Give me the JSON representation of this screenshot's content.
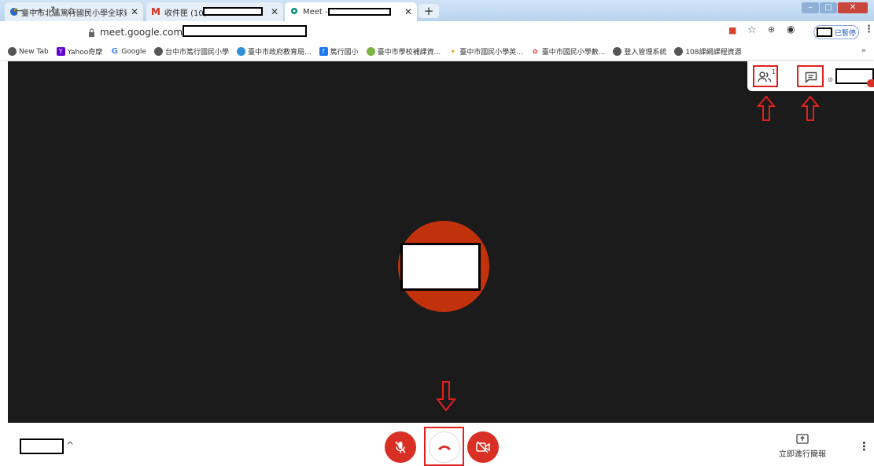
{
  "tabs": [
    {
      "title": "臺中市北區篤行國民小學全球資訊網",
      "active": false
    },
    {
      "title": "收件匣 (10)",
      "active": false
    },
    {
      "title": "Meet - ",
      "active": true
    }
  ],
  "address": {
    "url": "meet.google.com/o"
  },
  "profile": {
    "label": "已暫停"
  },
  "bookmarks": [
    {
      "label": "New Tab",
      "icon": "globe-icon"
    },
    {
      "label": "Yahoo奇摩",
      "icon": "yahoo-icon"
    },
    {
      "label": "Google",
      "icon": "google-icon"
    },
    {
      "label": "台中市篤行國民小學",
      "icon": "globe-icon"
    },
    {
      "label": "臺中市政府教育局...",
      "icon": "edu-icon"
    },
    {
      "label": "篤行國小",
      "icon": "facebook-icon"
    },
    {
      "label": "臺中市學校補課資...",
      "icon": "leaf-icon"
    },
    {
      "label": "臺中市國民小學英...",
      "icon": "figure-icon"
    },
    {
      "label": "臺中市國民小學數...",
      "icon": "flower-icon"
    },
    {
      "label": "登入管理系統",
      "icon": "globe-icon"
    },
    {
      "label": "108課綱課程資源",
      "icon": "globe-icon"
    }
  ],
  "bookmarks_more": "»",
  "meet": {
    "participants_count": "1",
    "present_now_label": "立即進行簡報"
  },
  "colors": {
    "annotation": "#e02020",
    "avatar": "#c1320c",
    "hangup": "#d93025",
    "stage": "#1b1b1b"
  }
}
